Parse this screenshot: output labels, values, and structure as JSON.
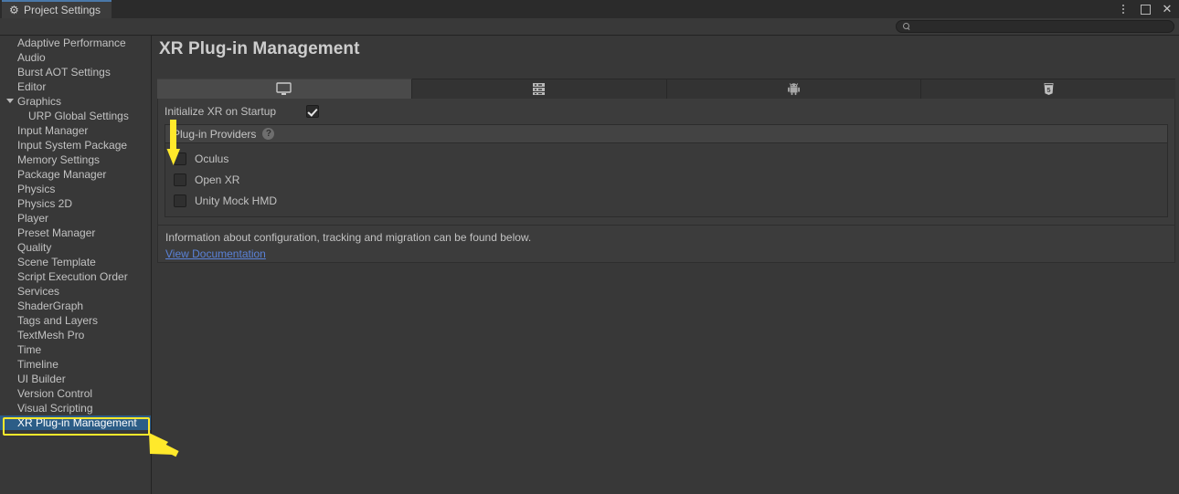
{
  "window": {
    "tab_title": "Project Settings",
    "tab_icon": "gear-icon",
    "controls": {
      "menu": "kebab-menu-icon",
      "maximize": "maximize-icon",
      "close": "close-icon"
    }
  },
  "search": {
    "placeholder": "",
    "value": "",
    "icon": "search-icon"
  },
  "sidebar": {
    "items": [
      {
        "label": "Adaptive Performance",
        "level": 0,
        "expandable": false,
        "selected": false
      },
      {
        "label": "Audio",
        "level": 0,
        "expandable": false,
        "selected": false
      },
      {
        "label": "Burst AOT Settings",
        "level": 0,
        "expandable": false,
        "selected": false
      },
      {
        "label": "Editor",
        "level": 0,
        "expandable": false,
        "selected": false
      },
      {
        "label": "Graphics",
        "level": 0,
        "expandable": true,
        "expanded": true,
        "selected": false
      },
      {
        "label": "URP Global Settings",
        "level": 1,
        "expandable": false,
        "selected": false
      },
      {
        "label": "Input Manager",
        "level": 0,
        "expandable": false,
        "selected": false
      },
      {
        "label": "Input System Package",
        "level": 0,
        "expandable": false,
        "selected": false
      },
      {
        "label": "Memory Settings",
        "level": 0,
        "expandable": false,
        "selected": false
      },
      {
        "label": "Package Manager",
        "level": 0,
        "expandable": false,
        "selected": false
      },
      {
        "label": "Physics",
        "level": 0,
        "expandable": false,
        "selected": false
      },
      {
        "label": "Physics 2D",
        "level": 0,
        "expandable": false,
        "selected": false
      },
      {
        "label": "Player",
        "level": 0,
        "expandable": false,
        "selected": false
      },
      {
        "label": "Preset Manager",
        "level": 0,
        "expandable": false,
        "selected": false
      },
      {
        "label": "Quality",
        "level": 0,
        "expandable": false,
        "selected": false
      },
      {
        "label": "Scene Template",
        "level": 0,
        "expandable": false,
        "selected": false
      },
      {
        "label": "Script Execution Order",
        "level": 0,
        "expandable": false,
        "selected": false
      },
      {
        "label": "Services",
        "level": 0,
        "expandable": false,
        "selected": false
      },
      {
        "label": "ShaderGraph",
        "level": 0,
        "expandable": false,
        "selected": false
      },
      {
        "label": "Tags and Layers",
        "level": 0,
        "expandable": false,
        "selected": false
      },
      {
        "label": "TextMesh Pro",
        "level": 0,
        "expandable": false,
        "selected": false
      },
      {
        "label": "Time",
        "level": 0,
        "expandable": false,
        "selected": false
      },
      {
        "label": "Timeline",
        "level": 0,
        "expandable": false,
        "selected": false
      },
      {
        "label": "UI Builder",
        "level": 0,
        "expandable": false,
        "selected": false
      },
      {
        "label": "Version Control",
        "level": 0,
        "expandable": false,
        "selected": false
      },
      {
        "label": "Visual Scripting",
        "level": 0,
        "expandable": false,
        "selected": false
      },
      {
        "label": "XR Plug-in Management",
        "level": 0,
        "expandable": false,
        "selected": true
      }
    ]
  },
  "main": {
    "title": "XR Plug-in Management",
    "platform_tabs": [
      {
        "icon": "desktop-icon",
        "active": true
      },
      {
        "icon": "server-icon",
        "active": false
      },
      {
        "icon": "android-icon",
        "active": false
      },
      {
        "icon": "webgl-icon",
        "active": false
      }
    ],
    "initialize_xr": {
      "label": "Initialize XR on Startup",
      "checked": true
    },
    "providers": {
      "header": "Plug-in Providers",
      "help_icon": "help-icon",
      "items": [
        {
          "label": "Oculus",
          "checked": false
        },
        {
          "label": "Open XR",
          "checked": false
        },
        {
          "label": "Unity Mock HMD",
          "checked": false
        }
      ]
    },
    "info": {
      "text": "Information about configuration, tracking and migration can be found below.",
      "link": "View Documentation"
    }
  },
  "annotations": {
    "color": "#ffe92b",
    "highlight_target": "XR Plug-in Management",
    "arrow_down_target": "Oculus",
    "arrow_diagonal_target": "XR Plug-in Management"
  }
}
